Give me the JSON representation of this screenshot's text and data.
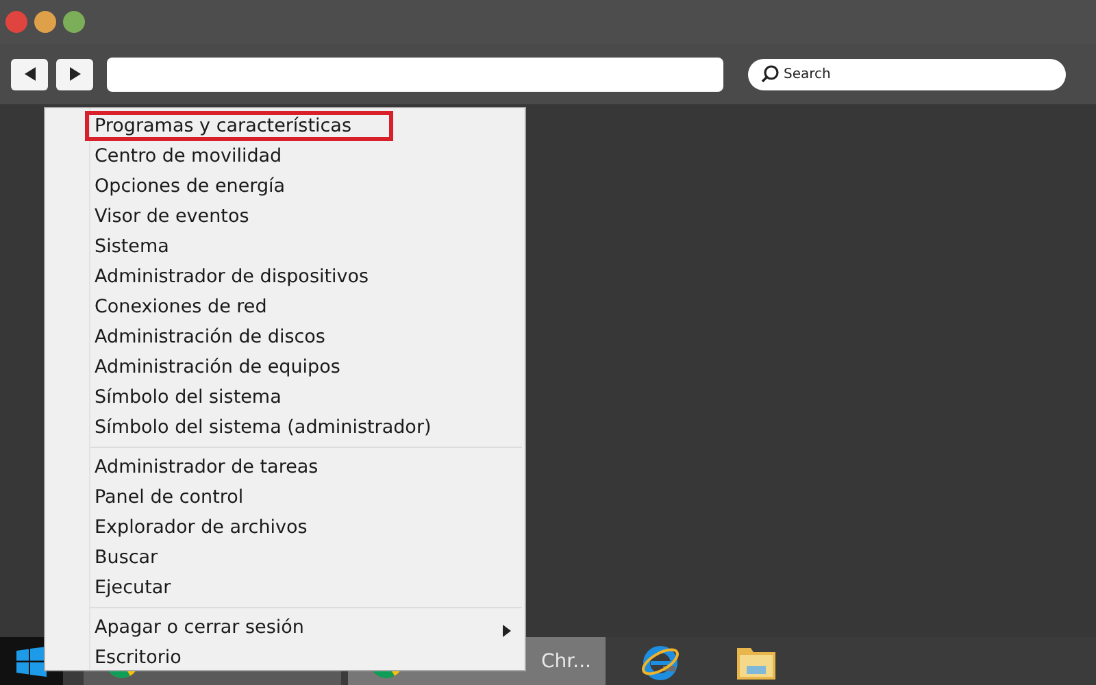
{
  "toolbar": {
    "search": {
      "placeholder": "Search"
    }
  },
  "context_menu": {
    "groups": [
      {
        "items": [
          {
            "label": "Programas y características",
            "highlighted": true,
            "submenu": false
          },
          {
            "label": "Centro de movilidad",
            "highlighted": false,
            "submenu": false
          },
          {
            "label": "Opciones de energía",
            "highlighted": false,
            "submenu": false
          },
          {
            "label": "Visor de eventos",
            "highlighted": false,
            "submenu": false
          },
          {
            "label": "Sistema",
            "highlighted": false,
            "submenu": false
          },
          {
            "label": "Administrador de dispositivos",
            "highlighted": false,
            "submenu": false
          },
          {
            "label": "Conexiones de red",
            "highlighted": false,
            "submenu": false
          },
          {
            "label": "Administración de discos",
            "highlighted": false,
            "submenu": false
          },
          {
            "label": "Administración de equipos",
            "highlighted": false,
            "submenu": false
          },
          {
            "label": "Símbolo del sistema",
            "highlighted": false,
            "submenu": false
          },
          {
            "label": "Símbolo del sistema (administrador)",
            "highlighted": false,
            "submenu": false
          }
        ]
      },
      {
        "items": [
          {
            "label": "Administrador de tareas",
            "highlighted": false,
            "submenu": false
          },
          {
            "label": "Panel de control",
            "highlighted": false,
            "submenu": false
          },
          {
            "label": "Explorador de archivos",
            "highlighted": false,
            "submenu": false
          },
          {
            "label": "Buscar",
            "highlighted": false,
            "submenu": false
          },
          {
            "label": "Ejecutar",
            "highlighted": false,
            "submenu": false
          }
        ]
      },
      {
        "items": [
          {
            "label": "Apagar o cerrar sesión",
            "highlighted": false,
            "submenu": true
          },
          {
            "label": "Escritorio",
            "highlighted": false,
            "submenu": false
          }
        ]
      }
    ]
  },
  "taskbar": {
    "items": [
      {
        "kind": "chrome"
      },
      {
        "kind": "chrome",
        "label": "Chr..."
      },
      {
        "kind": "ie"
      },
      {
        "kind": "folder"
      }
    ]
  }
}
